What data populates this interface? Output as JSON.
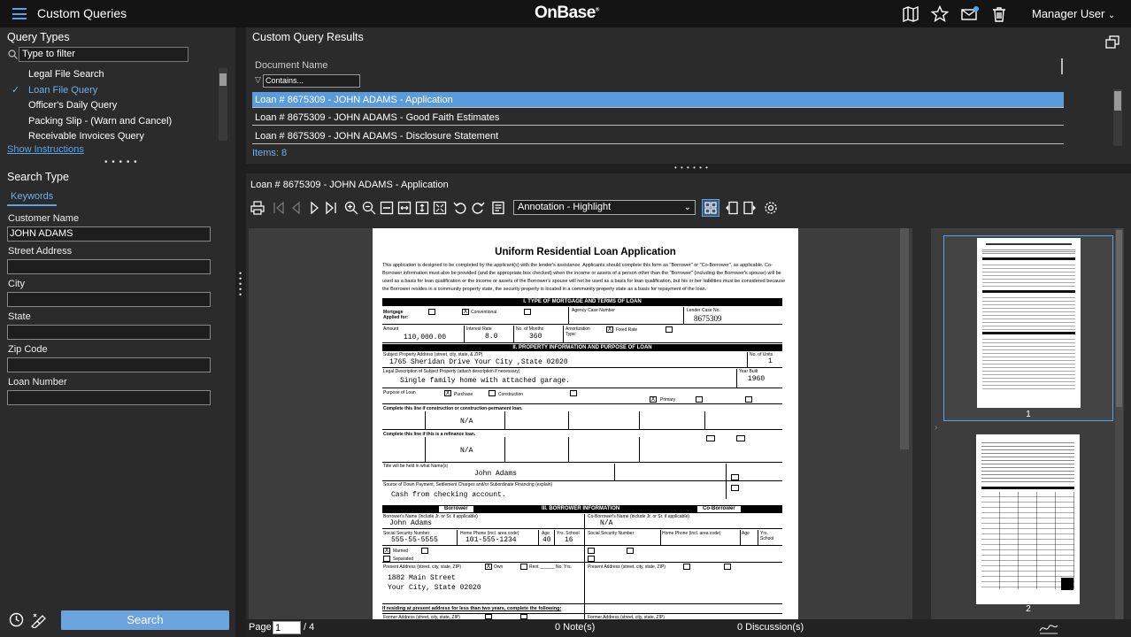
{
  "header": {
    "app_title": "Custom Queries",
    "logo": "OnBase",
    "user": "Manager User"
  },
  "icons": [
    "menu-icon",
    "book-icon",
    "star-icon",
    "mail-icon",
    "trash-icon",
    "chevron-down-icon"
  ],
  "left": {
    "query_types_title": "Query Types",
    "filter_placeholder": "Type to filter",
    "queries": [
      "Legal File Search",
      "Loan File Query",
      "Officer's Daily Query",
      "Packing Slip - (Warn and Cancel)",
      "Receivable Invoices Query"
    ],
    "selected_query": "Loan File Query",
    "show_instructions": "Show Instructions",
    "search_type_title": "Search Type",
    "keywords_tab": "Keywords",
    "fields": [
      {
        "label": "Customer Name",
        "value": "JOHN ADAMS"
      },
      {
        "label": "Street Address",
        "value": ""
      },
      {
        "label": "City",
        "value": ""
      },
      {
        "label": "State",
        "value": ""
      },
      {
        "label": "Zip Code",
        "value": ""
      },
      {
        "label": "Loan Number",
        "value": ""
      }
    ],
    "search_button": "Search"
  },
  "results": {
    "title": "Custom Query Results",
    "column": "Document Name",
    "contains_placeholder": "Contains...",
    "rows": [
      "Loan # 8675309 - JOHN ADAMS - Application",
      "Loan # 8675309 - JOHN ADAMS - Good Faith Estimates",
      "Loan # 8675309 - JOHN ADAMS - Disclosure Statement"
    ],
    "items_count": "Items: 8"
  },
  "viewer": {
    "doc_title": "Loan # 8675309 - JOHN ADAMS - Application",
    "annotation_select": "Annotation - Highlight",
    "page_label": "Page",
    "page_value": "1",
    "page_total": "/ 4",
    "notes": "0 Note(s)",
    "discussions": "0 Discussion(s)",
    "thumbs": [
      "1",
      "2"
    ]
  },
  "form": {
    "title": "Uniform Residential Loan Application",
    "intro": "This application is designed to be completed by the applicant(s) with the lender's assistance. Applicants should complete this form as \"Borrower\" or \"Co-Borrower\", as applicable. Co-Borrower information must also be provided (and the appropriate box checked) when the income or assets of a person other than the \"Borrower\" (including the Borrower's spouse) will be used as a basis for loan qualification or the income or assets of the Borrower's spouse will not be used as a basis for loan qualification, but his or her liabilities must be considered because the Borrower resides in a community property state, the security property is located in a community property state as a basis for repayment of the loan.",
    "sec1": "I.   TYPE OF MORTGAGE AND TERMS OF LOAN",
    "sec2": "II.   PROPERTY INFORMATION AND PURPOSE OF LOAN",
    "sec3": "III.   BORROWER INFORMATION",
    "borrower": "Borrower",
    "coborrower": "Co-Borrower",
    "lender_case": "8675309",
    "amount": "110,000.00",
    "rate": "8.0",
    "months": "360",
    "property_address": "1765 Sheridan Drive   Your City ,State  02020",
    "units": "1",
    "legal_desc": "Single family home with attached garage.",
    "year_built": "1960",
    "na1": "N/A",
    "na2": "N/A",
    "title_name": "John Adams",
    "down_payment": "Cash from checking account.",
    "borrower_name": "John Adams",
    "coborrower_name": "N/A",
    "ssn": "555-55-5555",
    "phone": "101-555-1234",
    "age": "40",
    "school": "16",
    "addr1": "1882 Main Street",
    "addr2": "Your City, State  02020",
    "bottom_note": "If residing at present address for less than two years, complete the following:"
  }
}
